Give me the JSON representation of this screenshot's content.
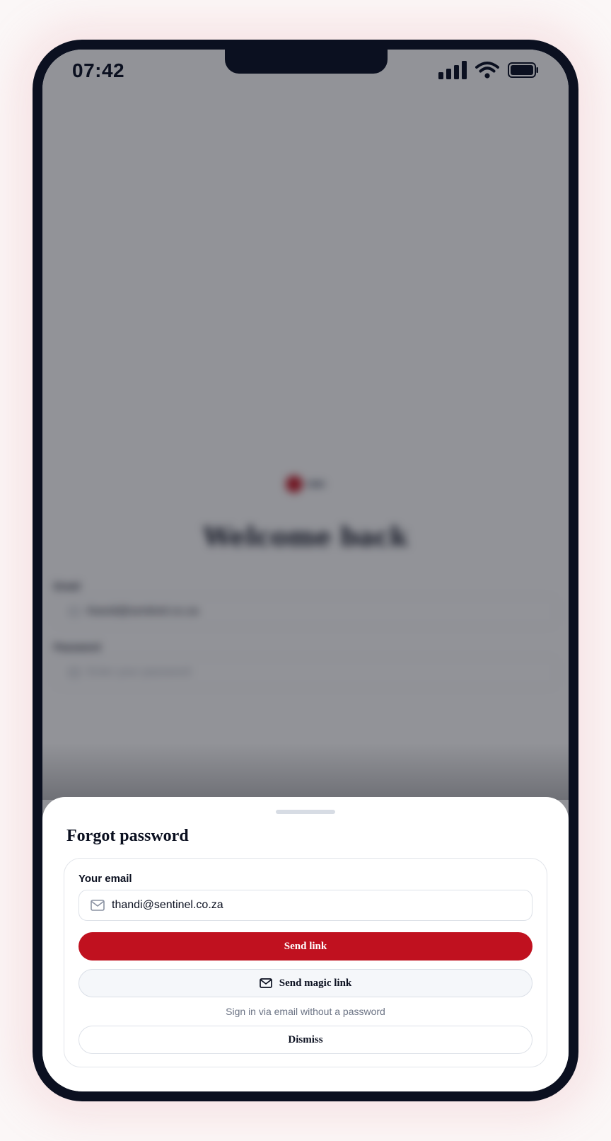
{
  "status_bar": {
    "time": "07:42"
  },
  "background": {
    "title": "Welcome back",
    "email_label": "Email",
    "email_value": "thandi@sentinel.co.za",
    "password_label": "Password",
    "password_placeholder": "Enter your password"
  },
  "sheet": {
    "title": "Forgot password",
    "email_label": "Your email",
    "email_value": "thandi@sentinel.co.za",
    "send_link_label": "Send link",
    "magic_link_label": "Send magic link",
    "helper_text": "Sign in via email without a password",
    "dismiss_label": "Dismiss"
  },
  "colors": {
    "accent": "#c0111f",
    "ink": "#0b1020",
    "muted": "#6b7384"
  }
}
